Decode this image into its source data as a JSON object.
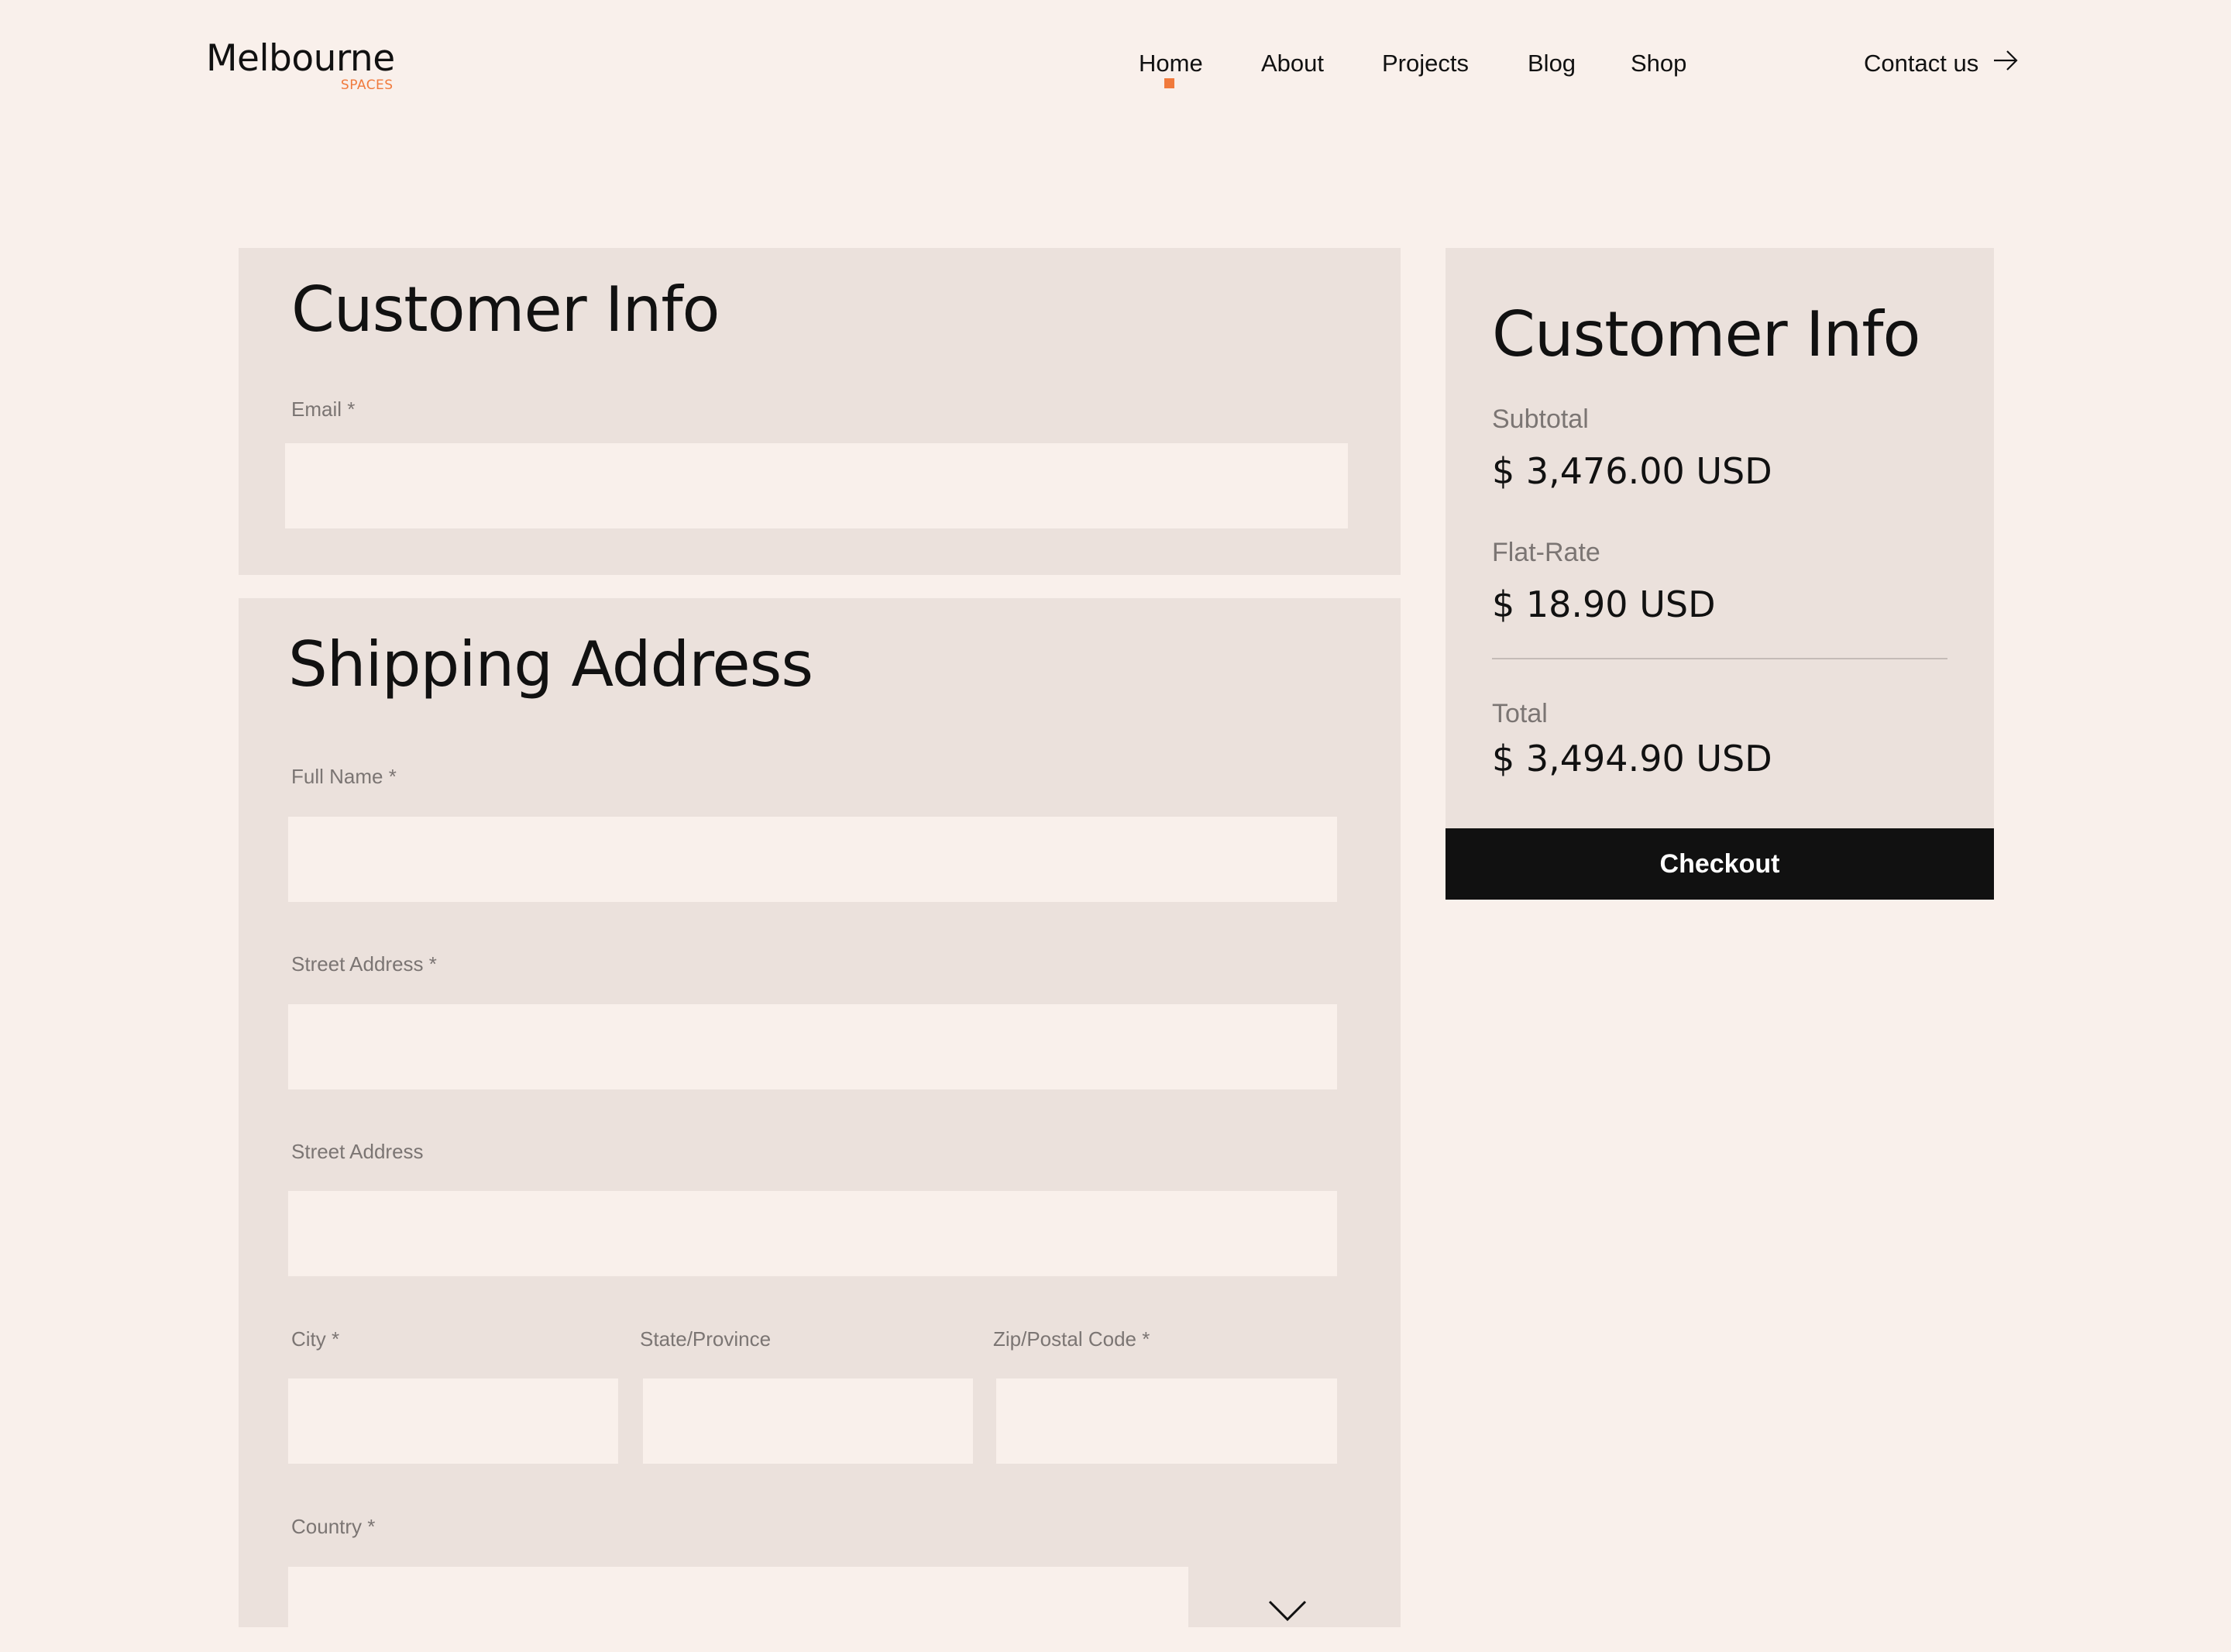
{
  "brand": {
    "name": "Melbourne",
    "tagline": "SPACES",
    "accent": "#f07a3c"
  },
  "nav": {
    "items": [
      {
        "label": "Home",
        "active": true
      },
      {
        "label": "About"
      },
      {
        "label": "Projects"
      },
      {
        "label": "Blog"
      },
      {
        "label": "Shop"
      }
    ],
    "contact": {
      "label": "Contact us",
      "icon": "arrow-right-icon"
    }
  },
  "customer_info": {
    "title": "Customer Info",
    "email": {
      "label": "Email *",
      "value": "",
      "placeholder": ""
    }
  },
  "shipping": {
    "title": "Shipping Address",
    "full_name": {
      "label": "Full Name *",
      "value": ""
    },
    "street1": {
      "label": "Street Address *",
      "value": ""
    },
    "street2": {
      "label": "Street Address",
      "value": ""
    },
    "city": {
      "label": "City *",
      "value": ""
    },
    "state": {
      "label": "State/Province",
      "value": ""
    },
    "zip": {
      "label": "Zip/Postal Code *",
      "value": ""
    },
    "country": {
      "label": "Country *",
      "value": "",
      "icon": "chevron-down-icon"
    }
  },
  "summary": {
    "title": "Customer Info",
    "subtotal": {
      "label": "Subtotal",
      "value": "$ 3,476.00 USD"
    },
    "flat_rate": {
      "label": "Flat-Rate",
      "value": "$ 18.90 USD"
    },
    "total": {
      "label": "Total",
      "value": "$ 3,494.90 USD"
    },
    "checkout_label": "Checkout"
  },
  "colors": {
    "page_bg": "#f9f0eb",
    "panel_bg": "#ebe1dc",
    "button_bg": "#111111"
  }
}
